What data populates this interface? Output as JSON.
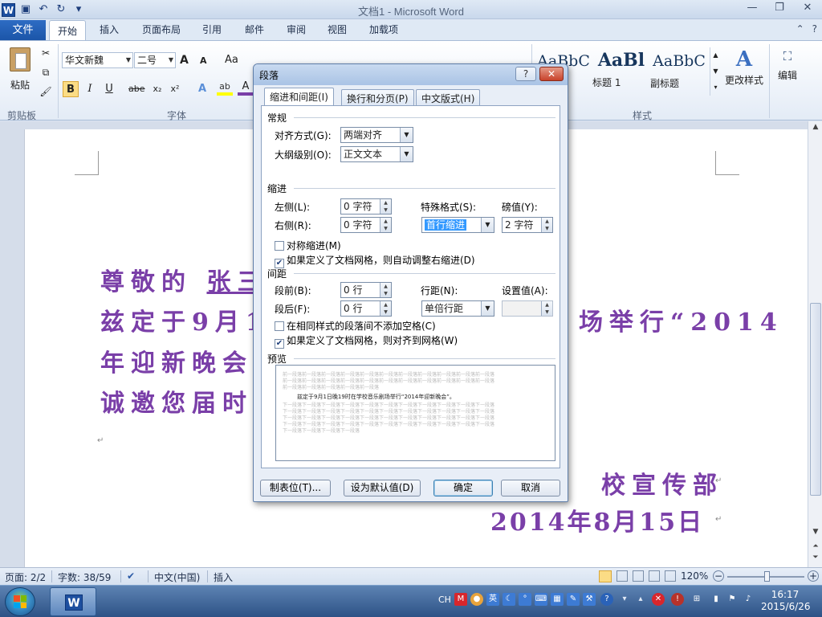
{
  "window": {
    "title": "文档1 - Microsoft Word",
    "app_icon": "W",
    "qat_icons": [
      "save-icon",
      "undo-icon",
      "redo-icon",
      "customize-icon"
    ],
    "minimize": "—",
    "restore": "❐",
    "close": "✕"
  },
  "ribbon_tabs": {
    "file": "文件",
    "tabs": [
      "开始",
      "插入",
      "页面布局",
      "引用",
      "邮件",
      "审阅",
      "视图",
      "加载项"
    ],
    "active_index": 0
  },
  "ribbon": {
    "clipboard": {
      "paste": "粘贴",
      "group": "剪贴板"
    },
    "font": {
      "name": "华文新魏",
      "size": "二号",
      "group": "字体",
      "grow": "A",
      "shrink": "A",
      "case": "Aa",
      "bold": "B",
      "italic": "I",
      "underline": "U",
      "strike": "abe",
      "sub": "x₂",
      "sup": "x²"
    },
    "styles": {
      "group": "样式",
      "items": [
        {
          "sample": "AaBbC",
          "name": ""
        },
        {
          "sample": "AaBl",
          "name": "标题 1"
        },
        {
          "sample": "AaBbC",
          "name": "副标题"
        }
      ],
      "change_styles": "更改样式"
    },
    "editing": {
      "label": "编辑"
    }
  },
  "document": {
    "line1_prefix": "尊敬的",
    "line1_name": "张三",
    "line2_start": "兹定于9月1",
    "line2_end": "场举行“2014",
    "line3": "年迎新晚会”",
    "line4": "诚邀您届时莅",
    "signature": "校宣传部",
    "date": "2014年8月15日",
    "mark": "↵"
  },
  "dialog": {
    "title": "段落",
    "help": "?",
    "close": "✕",
    "tabs": [
      "缩进和间距(I)",
      "换行和分页(P)",
      "中文版式(H)"
    ],
    "active_tab": 0,
    "general": {
      "section": "常规",
      "alignment_label": "对齐方式(G):",
      "alignment_value": "两端对齐",
      "outline_label": "大纲级别(O):",
      "outline_value": "正文文本"
    },
    "indent": {
      "section": "缩进",
      "left_label": "左侧(L):",
      "left_value": "0 字符",
      "right_label": "右侧(R):",
      "right_value": "0 字符",
      "special_label": "特殊格式(S):",
      "special_value": "首行缩进",
      "by_label": "磅值(Y):",
      "by_value": "2 字符",
      "mirror_label": "对称缩进(M)",
      "mirror_checked": false,
      "auto_label": "如果定义了文档网格，则自动调整右缩进(D)",
      "auto_checked": true
    },
    "spacing": {
      "section": "间距",
      "before_label": "段前(B):",
      "before_value": "0 行",
      "after_label": "段后(F):",
      "after_value": "0 行",
      "line_label": "行距(N):",
      "line_value": "单倍行距",
      "at_label": "设置值(A):",
      "at_value": "",
      "nospace_label": "在相同样式的段落间不添加空格(C)",
      "nospace_checked": false,
      "grid_label": "如果定义了文档网格，则对齐到网格(W)",
      "grid_checked": true
    },
    "preview": {
      "section": "预览",
      "prev_lines": [
        "前一段落前一段落前一段落前一段落前一段落前一段落前一段落前一段落前一段落前一段落前一段落",
        "前一段落前一段落前一段落前一段落前一段落前一段落前一段落前一段落前一段落前一段落前一段落",
        "前一段落前一段落前一段落前一段落前一段落"
      ],
      "main_line": "兹定于9月1日晚19时在学校音乐剧场举行“2014年迎新晚会”。",
      "next_lines": [
        "下一段落下一段落下一段落下一段落下一段落下一段落下一段落下一段落下一段落下一段落下一段落",
        "下一段落下一段落下一段落下一段落下一段落下一段落下一段落下一段落下一段落下一段落下一段落",
        "下一段落下一段落下一段落下一段落下一段落下一段落下一段落下一段落下一段落下一段落下一段落",
        "下一段落下一段落下一段落下一段落下一段落下一段落下一段落下一段落下一段落下一段落下一段落",
        "下一段落下一段落下一段落下一段落"
      ]
    },
    "buttons": {
      "tabs": "制表位(T)...",
      "default": "设为默认值(D)",
      "ok": "确定",
      "cancel": "取消"
    }
  },
  "statusbar": {
    "page": "页面: 2/2",
    "words": "字数: 38/59",
    "language": "中文(中国)",
    "mode": "插入",
    "zoom": "120%"
  },
  "taskbar": {
    "lang": "CH",
    "time": "16:17",
    "date": "2015/6/26"
  }
}
